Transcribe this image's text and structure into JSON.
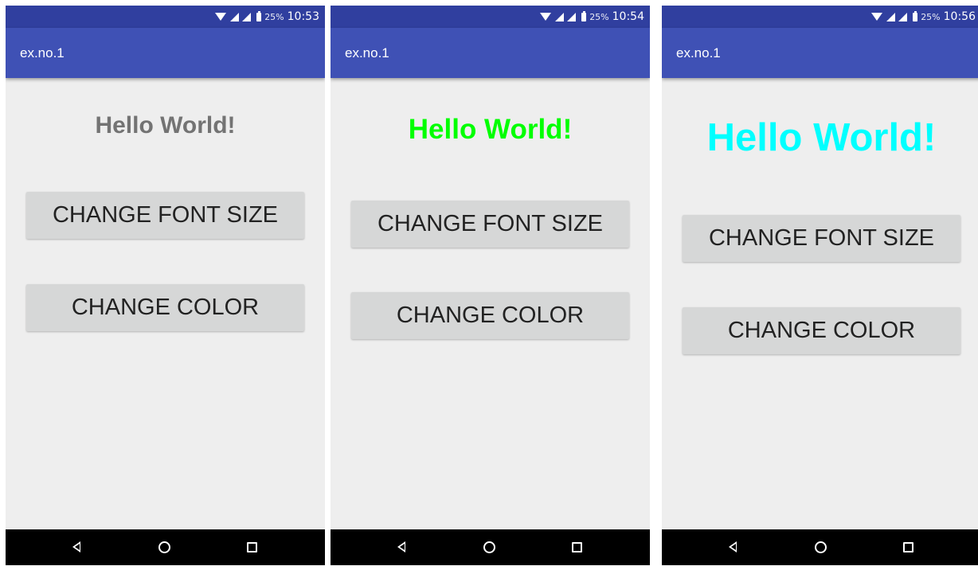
{
  "status": {
    "battery": "25%"
  },
  "app": {
    "title": "ex.no.1"
  },
  "buttons": {
    "font_size": "CHANGE FONT SIZE",
    "color": "CHANGE COLOR"
  },
  "phones": [
    {
      "time": "10:53",
      "hello": "Hello World!",
      "hello_color": "#737373"
    },
    {
      "time": "10:54",
      "hello": "Hello World!",
      "hello_color": "#00ff00"
    },
    {
      "time": "10:56",
      "hello": "Hello World!",
      "hello_color": "#00ffff"
    }
  ],
  "colors": {
    "status_bar": "#303f9f",
    "app_bar": "#3f51b5",
    "background": "#eeeeee",
    "button": "#d6d7d7",
    "nav_bar": "#000000"
  },
  "icons": [
    "wifi-icon",
    "signal-icon",
    "battery-icon",
    "back-icon",
    "home-icon",
    "recents-icon"
  ]
}
